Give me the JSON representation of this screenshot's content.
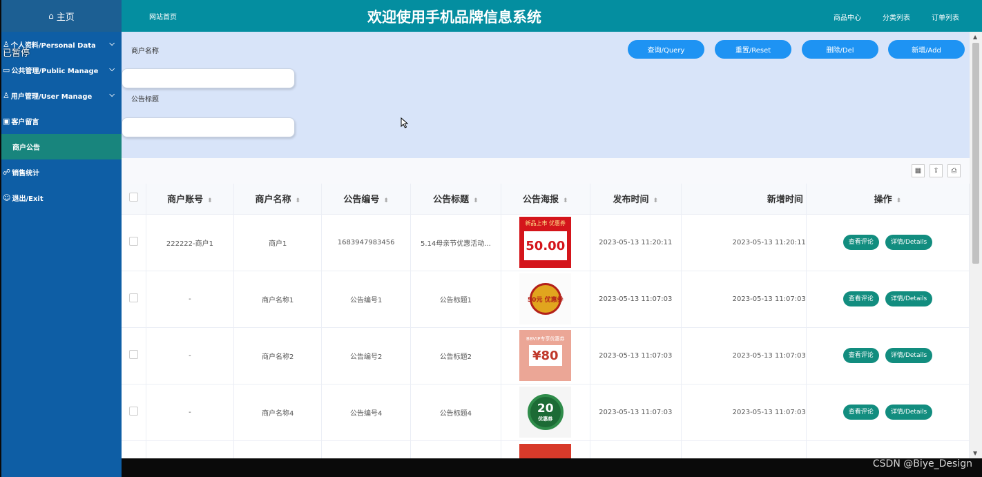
{
  "sidebar": {
    "home": "主页",
    "items": [
      {
        "label": "个人资料/Personal Data",
        "icon": "user-icon",
        "expandable": true
      },
      {
        "label": "公共管理/Public Manage",
        "icon": "monitor-icon",
        "expandable": true
      },
      {
        "label": "用户管理/User Manage",
        "icon": "users-icon",
        "expandable": true
      },
      {
        "label": "客户留言",
        "icon": "message-icon",
        "expandable": false
      },
      {
        "label": "商户公告",
        "icon": "",
        "expandable": false,
        "active": true
      },
      {
        "label": "销售统计",
        "icon": "chart-icon",
        "expandable": false
      },
      {
        "label": "退出/Exit",
        "icon": "exit-icon",
        "expandable": false
      }
    ]
  },
  "overlay": {
    "paused": "已暂停"
  },
  "topbar": {
    "home_link": "网站首页",
    "title": "欢迎使用手机品牌信息系统",
    "links": [
      "商品中心",
      "分类列表",
      "订单列表"
    ]
  },
  "search": {
    "field1_label": "商户名称",
    "field1_value": "",
    "field2_label": "公告标题",
    "field2_value": "",
    "buttons": [
      "查询/Query",
      "重置/Reset",
      "删除/Del",
      "新增/Add"
    ]
  },
  "table": {
    "headers": [
      "商户账号",
      "商户名称",
      "公告编号",
      "公告标题",
      "公告海报",
      "发布时间",
      "新增时间",
      "操作"
    ],
    "rows": [
      {
        "account": "222222-商户1",
        "name": "商户1",
        "number": "1683947983456",
        "title": "5.14母亲节优惠活动...",
        "published": "2023-05-13 11:20:11",
        "added": "2023-05-13 11:20:11",
        "poster_text": "50.00",
        "poster_head": "新品上市 优惠券"
      },
      {
        "account": "-",
        "name": "商户名称1",
        "number": "公告编号1",
        "title": "公告标题1",
        "published": "2023-05-13 11:07:03",
        "added": "2023-05-13 11:07:03",
        "poster_text": "50元 优惠券",
        "poster_head": ""
      },
      {
        "account": "-",
        "name": "商户名称2",
        "number": "公告编号2",
        "title": "公告标题2",
        "published": "2023-05-13 11:07:03",
        "added": "2023-05-13 11:07:03",
        "poster_text": "¥80",
        "poster_head": "BBVIP专享优惠券"
      },
      {
        "account": "-",
        "name": "商户名称4",
        "number": "公告编号4",
        "title": "公告标题4",
        "published": "2023-05-13 11:07:03",
        "added": "2023-05-13 11:07:03",
        "poster_text": "20",
        "poster_head": "优惠券"
      }
    ],
    "action_comment": "查看评论",
    "action_details": "详情/Details"
  },
  "colors": {
    "sidebar": "#0e5ea5",
    "topbar": "#048ea0",
    "active": "#18857d",
    "primary_button": "#1e93f3",
    "action_button": "#128d7f"
  },
  "watermark": "CSDN @Biye_Design"
}
